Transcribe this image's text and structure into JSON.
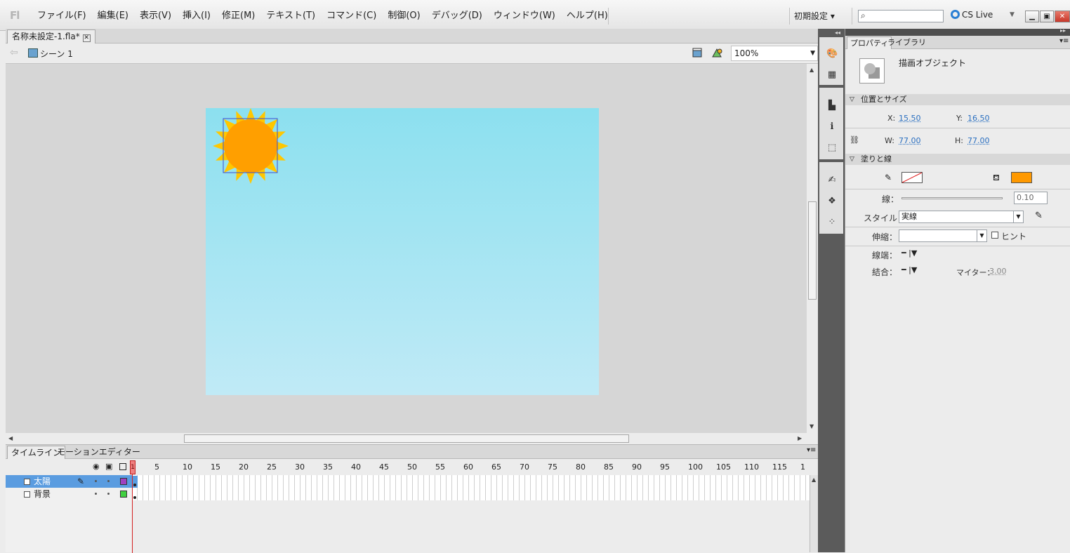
{
  "app": {
    "logo": "Fl"
  },
  "menu": [
    "ファイル(F)",
    "編集(E)",
    "表示(V)",
    "挿入(I)",
    "修正(M)",
    "テキスト(T)",
    "コマンド(C)",
    "制御(O)",
    "デバッグ(D)",
    "ウィンドウ(W)",
    "ヘルプ(H)"
  ],
  "workspace": "初期設定 ▾",
  "search": {
    "value": ""
  },
  "cs_live": "CS Live",
  "document": {
    "tab": "名称未設定-1.fla*",
    "scene": "シーン 1",
    "zoom": "100%"
  },
  "colors": {
    "stage_top": "#8ce0ef",
    "stage_bottom": "#c0eaf6",
    "sun_fill": "#ff9f00",
    "sun_rays": "#ffc700",
    "fill_color": "#ff9900",
    "layer_selected": "#5a9ce0"
  },
  "timeline": {
    "tabs": [
      "タイムライン",
      "モーションエディター"
    ],
    "frame_numbers": [
      "1",
      "5",
      "10",
      "15",
      "20",
      "25",
      "30",
      "35",
      "40",
      "45",
      "50",
      "55",
      "60",
      "65",
      "70",
      "75",
      "80",
      "85",
      "90",
      "95",
      "100",
      "105",
      "110",
      "115",
      "1"
    ],
    "layers": [
      {
        "name": "太陽",
        "selected": true,
        "color": "#a040c0"
      },
      {
        "name": "背景",
        "selected": false,
        "color": "#40d040"
      }
    ]
  },
  "properties": {
    "tabs": [
      "プロパティ",
      "ライブラリ"
    ],
    "object_type": "描画オブジェクト",
    "position_size": {
      "title": "位置とサイズ",
      "x_label": "X:",
      "x": "15.50",
      "y_label": "Y:",
      "y": "16.50",
      "w_label": "W:",
      "w": "77.00",
      "h_label": "H:",
      "h": "77.00"
    },
    "fill_stroke": {
      "title": "塗りと線",
      "stroke_label": "線：",
      "stroke_value": "0.10",
      "style_label": "スタイル：",
      "style_value": "実線",
      "scale_label": "伸縮：",
      "scale_value": "",
      "hint_label": "ヒント",
      "cap_label": "線端：",
      "join_label": "結合：",
      "miter_label": "マイター：",
      "miter_value": "3.00"
    }
  }
}
